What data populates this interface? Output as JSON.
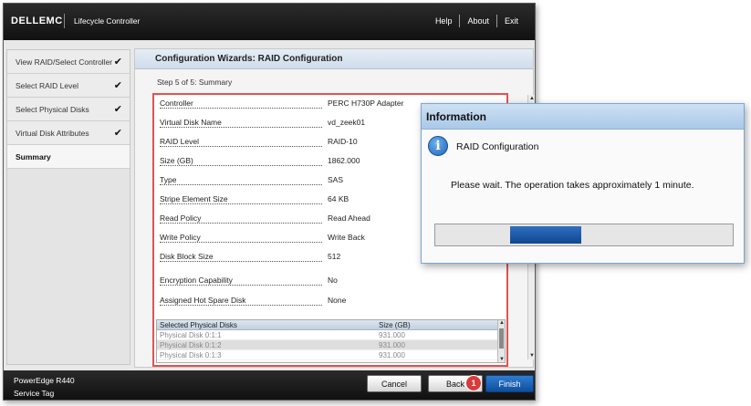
{
  "header": {
    "brand": "DELLEMC",
    "app_title": "Lifecycle Controller",
    "links": [
      "Help",
      "About",
      "Exit"
    ]
  },
  "sidebar": {
    "items": [
      {
        "label": "View RAID/Select Controller",
        "checked": true
      },
      {
        "label": "Select RAID Level",
        "checked": true
      },
      {
        "label": "Select Physical Disks",
        "checked": true
      },
      {
        "label": "Virtual Disk Attributes",
        "checked": true
      },
      {
        "label": "Summary",
        "checked": false,
        "active": true
      }
    ],
    "check_glyph": "✔"
  },
  "main": {
    "title": "Configuration Wizards: RAID Configuration",
    "step": "Step 5 of 5: Summary",
    "summary": [
      {
        "label": "Controller",
        "value": "PERC H730P Adapter"
      },
      {
        "label": "Virtual Disk Name",
        "value": "vd_zeek01"
      },
      {
        "label": "RAID Level",
        "value": "RAID-10"
      },
      {
        "label": "Size (GB)",
        "value": "1862.000"
      },
      {
        "label": "Type",
        "value": "SAS"
      },
      {
        "label": "Stripe Element Size",
        "value": "64 KB"
      },
      {
        "label": "Read Policy",
        "value": "Read Ahead"
      },
      {
        "label": "Write Policy",
        "value": "Write Back"
      },
      {
        "label": "Disk Block Size",
        "value": "512"
      },
      {
        "label": "Encryption Capability",
        "value": "No"
      },
      {
        "label": "Assigned Hot Spare Disk",
        "value": "None"
      }
    ],
    "disk_table": {
      "headers": [
        "Selected Physical Disks",
        "Size (GB)"
      ],
      "rows": [
        [
          "Physical Disk 0:1:1",
          "931.000"
        ],
        [
          "Physical Disk 0:1:2",
          "931.000"
        ],
        [
          "Physical Disk 0:1:3",
          "931.000"
        ]
      ]
    }
  },
  "footer": {
    "model": "PowerEdge R440",
    "service_tag": "Service Tag",
    "cancel_label": "Cancel",
    "back_label": "Back",
    "finish_label": "Finish",
    "badge": "1"
  },
  "dialog": {
    "title": "Information",
    "heading": "RAID Configuration",
    "message": "Please wait. The operation takes approximately 1 minute.",
    "icon": "info-icon",
    "progress_segment": {
      "start": 0.25,
      "end": 0.49
    }
  },
  "colors": {
    "highlight_border": "#e05252",
    "finish_button": "#1f66bd",
    "badge": "#d93a3a",
    "progress": "#1a57a6"
  }
}
